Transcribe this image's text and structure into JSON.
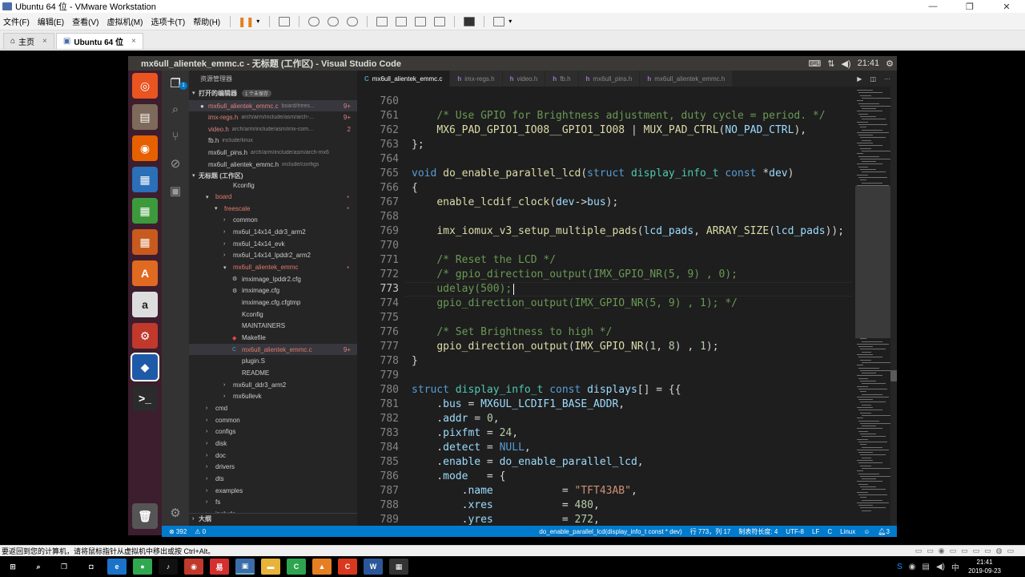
{
  "vmware": {
    "title": "Ubuntu 64 位 - VMware Workstation",
    "menu": [
      "文件(F)",
      "编辑(E)",
      "查看(V)",
      "虚拟机(M)",
      "选项卡(T)",
      "帮助(H)"
    ],
    "tabs": [
      {
        "label": "主页"
      },
      {
        "label": "Ubuntu 64 位"
      }
    ],
    "status_hint": "要返回到您的计算机，请将鼠标指针从虚拟机中移出或按 Ctrl+Alt。",
    "win_min": "—",
    "win_max": "❐",
    "win_close": "✕",
    "tab_close": "×"
  },
  "ubuntu": {
    "window_title": "mx6ull_alientek_emmc.c - 无标题 (工作区) - Visual Studio Code",
    "time": "21:41",
    "launcher": [
      {
        "name": "dash",
        "glyph": "◎",
        "color": "#e95420"
      },
      {
        "name": "files",
        "glyph": "▤",
        "color": "#7d6a5a"
      },
      {
        "name": "firefox",
        "glyph": "◉",
        "color": "#e66000"
      },
      {
        "name": "writer",
        "glyph": "▦",
        "color": "#2a6fb8"
      },
      {
        "name": "calc",
        "glyph": "▦",
        "color": "#3c9a3c"
      },
      {
        "name": "impress",
        "glyph": "▦",
        "color": "#c85a1e"
      },
      {
        "name": "software",
        "glyph": "A",
        "color": "#e06a20"
      },
      {
        "name": "amazon",
        "glyph": "a",
        "color": "#ddd"
      },
      {
        "name": "settings",
        "glyph": "⚙",
        "color": "#c0392b"
      },
      {
        "name": "vscode",
        "glyph": "◆",
        "color": "#1e5aa8"
      },
      {
        "name": "terminal",
        "glyph": ">_",
        "color": "#2b2b2b"
      }
    ]
  },
  "vscode": {
    "explorer_title": "资源管理器",
    "open_editors_label": "打开的编辑器",
    "unsaved_badge": "1 个未保存",
    "workspace_label": "无标题 (工作区)",
    "outline_label": "大纲",
    "open_editors": [
      {
        "name": "mx6ull_alientek_emmc.c",
        "path": "board/frees...",
        "badge": "9+",
        "modified": true
      },
      {
        "name": "imx-regs.h",
        "path": "arch/arm/include/asm/arch-...",
        "badge": "9+"
      },
      {
        "name": "video.h",
        "path": "arch/arm/include/asm/imx-com...",
        "badge": "2"
      },
      {
        "name": "fb.h",
        "path": "include/linux",
        "badge": ""
      },
      {
        "name": "mx6ull_pins.h",
        "path": "arch/arm/include/asm/arch-mx6",
        "badge": ""
      },
      {
        "name": "mx6ull_alientek_emmc.h",
        "path": "include/configs",
        "badge": ""
      }
    ],
    "tree": [
      {
        "name": "Kconfig",
        "depth": 3,
        "kind": "file"
      },
      {
        "name": "board",
        "depth": 1,
        "kind": "open"
      },
      {
        "name": "freescale",
        "depth": 2,
        "kind": "open"
      },
      {
        "name": "common",
        "depth": 3,
        "kind": "closed"
      },
      {
        "name": "mx6ul_14x14_ddr3_arm2",
        "depth": 3,
        "kind": "closed"
      },
      {
        "name": "mx6ul_14x14_evk",
        "depth": 3,
        "kind": "closed"
      },
      {
        "name": "mx6ul_14x14_lpddr2_arm2",
        "depth": 3,
        "kind": "closed"
      },
      {
        "name": "mx6ull_alientek_emmc",
        "depth": 3,
        "kind": "open"
      },
      {
        "name": "imximage_lpddr2.cfg",
        "depth": 4,
        "kind": "gear"
      },
      {
        "name": "imximage.cfg",
        "depth": 4,
        "kind": "gear"
      },
      {
        "name": "imximage.cfg.cfgtmp",
        "depth": 4,
        "kind": "file"
      },
      {
        "name": "Kconfig",
        "depth": 4,
        "kind": "file"
      },
      {
        "name": "MAINTAINERS",
        "depth": 4,
        "kind": "file"
      },
      {
        "name": "Makefile",
        "depth": 4,
        "kind": "make"
      },
      {
        "name": "mx6ull_alientek_emmc.c",
        "depth": 4,
        "kind": "cfile",
        "badge": "9+"
      },
      {
        "name": "plugin.S",
        "depth": 4,
        "kind": "file"
      },
      {
        "name": "README",
        "depth": 4,
        "kind": "file"
      },
      {
        "name": "mx6ull_ddr3_arm2",
        "depth": 3,
        "kind": "closed"
      },
      {
        "name": "mx6ullevk",
        "depth": 3,
        "kind": "closed"
      },
      {
        "name": "cmd",
        "depth": 1,
        "kind": "closed"
      },
      {
        "name": "common",
        "depth": 1,
        "kind": "closed"
      },
      {
        "name": "configs",
        "depth": 1,
        "kind": "closed"
      },
      {
        "name": "disk",
        "depth": 1,
        "kind": "closed"
      },
      {
        "name": "doc",
        "depth": 1,
        "kind": "closed"
      },
      {
        "name": "drivers",
        "depth": 1,
        "kind": "closed"
      },
      {
        "name": "dts",
        "depth": 1,
        "kind": "closed"
      },
      {
        "name": "examples",
        "depth": 1,
        "kind": "closed"
      },
      {
        "name": "fs",
        "depth": 1,
        "kind": "closed"
      },
      {
        "name": "include",
        "depth": 1,
        "kind": "closed"
      }
    ],
    "tabs": [
      "mx6ull_alientek_emmc.c",
      "imx-regs.h",
      "video.h",
      "fb.h",
      "mx6ull_pins.h",
      "mx6ull_alientek_emmc.h"
    ],
    "current_line": 773,
    "code": [
      {
        "ln": 760,
        "html": ""
      },
      {
        "ln": 761,
        "html": "    <span class=\"c\">/* Use GPIO for Brightness adjustment, duty cycle = period. */</span>"
      },
      {
        "ln": 762,
        "html": "    <span class=\"f\">MX6_PAD_GPIO1_IO08__GPIO1_IO08</span> | <span class=\"f\">MUX_PAD_CTRL</span>(<span class=\"v\">NO_PAD_CTRL</span>),"
      },
      {
        "ln": 763,
        "html": "};"
      },
      {
        "ln": 764,
        "html": ""
      },
      {
        "ln": 765,
        "html": "<span class=\"k\">void</span> <span class=\"f\">do_enable_parallel_lcd</span>(<span class=\"k\">struct</span> <span class=\"ty\">display_info_t</span> <span class=\"k\">const</span> *<span class=\"v\">dev</span>)"
      },
      {
        "ln": 766,
        "html": "{"
      },
      {
        "ln": 767,
        "html": "    <span class=\"f\">enable_lcdif_clock</span>(<span class=\"v\">dev</span>-&gt;<span class=\"v\">bus</span>);"
      },
      {
        "ln": 768,
        "html": ""
      },
      {
        "ln": 769,
        "html": "    <span class=\"f\">imx_iomux_v3_setup_multiple_pads</span>(<span class=\"v\">lcd_pads</span>, <span class=\"f\">ARRAY_SIZE</span>(<span class=\"v\">lcd_pads</span>));"
      },
      {
        "ln": 770,
        "html": ""
      },
      {
        "ln": 771,
        "html": "    <span class=\"c\">/* Reset the LCD */</span>"
      },
      {
        "ln": 772,
        "html": "    <span class=\"c\">/* gpio_direction_output(IMX_GPIO_NR(5, 9) , 0);</span>"
      },
      {
        "ln": 773,
        "html": "    <span class=\"c\">udelay(500);</span>"
      },
      {
        "ln": 774,
        "html": "    <span class=\"c\">gpio_direction_output(IMX_GPIO_NR(5, 9) , 1); */</span>"
      },
      {
        "ln": 775,
        "html": ""
      },
      {
        "ln": 776,
        "html": "    <span class=\"c\">/* Set Brightness to high */</span>"
      },
      {
        "ln": 777,
        "html": "    <span class=\"f\">gpio_direction_output</span>(<span class=\"f\">IMX_GPIO_NR</span>(<span class=\"n\">1</span>, <span class=\"n\">8</span>) , <span class=\"n\">1</span>);"
      },
      {
        "ln": 778,
        "html": "}"
      },
      {
        "ln": 779,
        "html": ""
      },
      {
        "ln": 780,
        "html": "<span class=\"k\">struct</span> <span class=\"ty\">display_info_t</span> <span class=\"k\">const</span> <span class=\"v\">displays</span>[] = {{"
      },
      {
        "ln": 781,
        "html": "    .<span class=\"v\">bus</span> = <span class=\"v\">MX6UL_LCDIF1_BASE_ADDR</span>,"
      },
      {
        "ln": 782,
        "html": "    .<span class=\"v\">addr</span> = <span class=\"n\">0</span>,"
      },
      {
        "ln": 783,
        "html": "    .<span class=\"v\">pixfmt</span> = <span class=\"n\">24</span>,"
      },
      {
        "ln": 784,
        "html": "    .<span class=\"v\">detect</span> = <span class=\"k\">NULL</span>,"
      },
      {
        "ln": 785,
        "html": "    .<span class=\"v\">enable</span> = <span class=\"v\">do_enable_parallel_lcd</span>,"
      },
      {
        "ln": 786,
        "html": "    .<span class=\"v\">mode</span>   = {"
      },
      {
        "ln": 787,
        "html": "        .<span class=\"v\">name</span>           = <span class=\"s\">\"TFT43AB\"</span>,"
      },
      {
        "ln": 788,
        "html": "        .<span class=\"v\">xres</span>           = <span class=\"n\">480</span>,"
      },
      {
        "ln": 789,
        "html": "        .<span class=\"v\">yres</span>           = <span class=\"n\">272</span>,"
      }
    ],
    "status": {
      "errors": "⊗ 392",
      "warnings": "⚠ 0",
      "function": "do_enable_parallel_lcd(display_info_t const * dev)",
      "position": "行 773，列 17",
      "tab_size": "制表符长度: 4",
      "encoding": "UTF-8",
      "eol": "LF",
      "language": "C",
      "platform": "Linux",
      "notifications": "3"
    }
  },
  "host": {
    "date": "2019-09-23",
    "time": "21:41",
    "taskbar": [
      {
        "name": "start",
        "glyph": "⊞",
        "color": "#000"
      },
      {
        "name": "search",
        "glyph": "⌕",
        "color": "#000"
      },
      {
        "name": "task-view",
        "glyph": "❐",
        "color": "#000"
      },
      {
        "name": "camera-app",
        "glyph": "◘",
        "color": "#000"
      },
      {
        "name": "edge",
        "glyph": "e",
        "color": "#1a73c8"
      },
      {
        "name": "green-app",
        "glyph": "●",
        "color": "#2fa84f"
      },
      {
        "name": "music-app",
        "glyph": "♪",
        "color": "#111"
      },
      {
        "name": "netease",
        "glyph": "◉",
        "color": "#c0392b"
      },
      {
        "name": "red-app",
        "glyph": "易",
        "color": "#d32f2f"
      },
      {
        "name": "vmware",
        "glyph": "▣",
        "color": "#3b6ea8"
      },
      {
        "name": "folder",
        "glyph": "▬",
        "color": "#e8b33a"
      },
      {
        "name": "camtasia",
        "glyph": "C",
        "color": "#2ea44f"
      },
      {
        "name": "orange-app",
        "glyph": "▲",
        "color": "#e67e22"
      },
      {
        "name": "red-c-app",
        "glyph": "C",
        "color": "#d9381e"
      },
      {
        "name": "word",
        "glyph": "W",
        "color": "#2b579a"
      },
      {
        "name": "calculator",
        "glyph": "▦",
        "color": "#333"
      }
    ]
  }
}
